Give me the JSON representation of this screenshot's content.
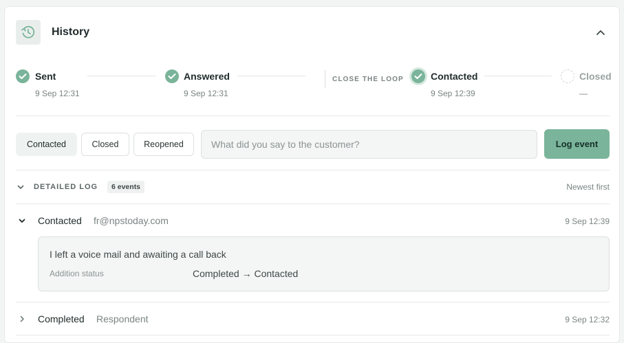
{
  "header": {
    "title": "History"
  },
  "steps": [
    {
      "label": "Sent",
      "time": "9 Sep 12:31",
      "state": "done"
    },
    {
      "label": "Answered",
      "time": "9 Sep 12:31",
      "state": "done"
    },
    {
      "label": "Contacted",
      "time": "9 Sep 12:39",
      "state": "active"
    },
    {
      "label": "Closed",
      "time": "—",
      "state": "pending"
    }
  ],
  "close_the_loop_label": "CLOSE THE LOOP",
  "actions": {
    "contacted": "Contacted",
    "closed": "Closed",
    "reopened": "Reopened",
    "selected": "contacted",
    "input_placeholder": "What did you say to the customer?",
    "log_button": "Log event"
  },
  "log": {
    "title": "DETAILED LOG",
    "count": "6 events",
    "sort": "Newest first",
    "entries": [
      {
        "event": "Contacted",
        "who": "fr@npstoday.com",
        "time": "9 Sep 12:39",
        "expanded": true,
        "note": "I left a voice mail and awaiting a call back",
        "field_label": "Addition status",
        "field_value": "Completed → Contacted"
      },
      {
        "event": "Completed",
        "who": "Respondent",
        "time": "9 Sep 12:32",
        "expanded": false
      }
    ]
  },
  "colors": {
    "accent": "#7ab49a",
    "accent_text": "#16302a",
    "border": "#e6e8e8"
  },
  "icons": {
    "history": "history-clock-icon",
    "collapse": "chevron-up-icon",
    "check": "check-icon"
  }
}
